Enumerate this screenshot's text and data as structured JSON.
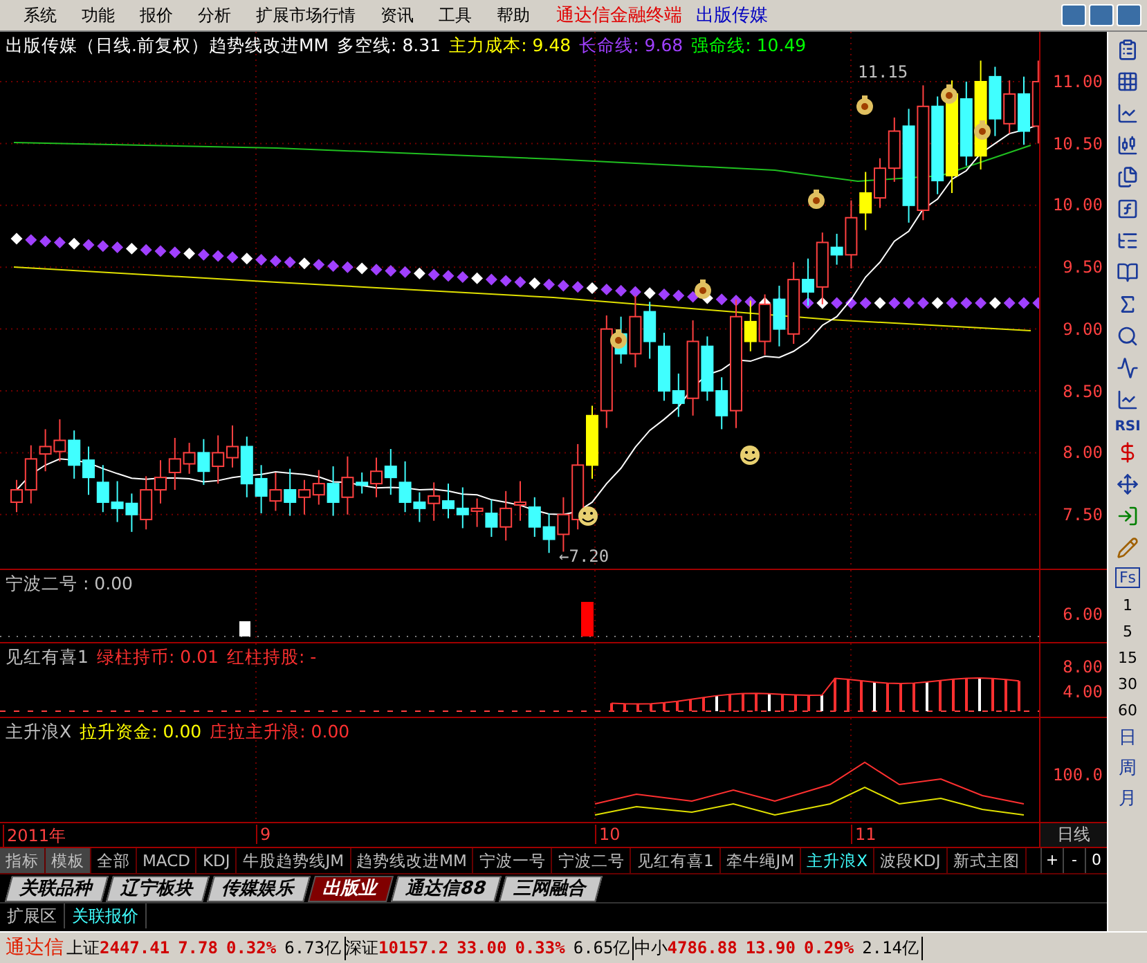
{
  "menu": [
    "系统",
    "功能",
    "报价",
    "分析",
    "扩展市场行情",
    "资讯",
    "工具",
    "帮助"
  ],
  "brand": {
    "product": "通达信金融终端",
    "stock": "出版传媒"
  },
  "chart": {
    "legend": [
      {
        "text": "出版传媒（日线.前复权）趋势线改进MM",
        "color": "#ffffff"
      },
      {
        "text": "多空线: 8.31",
        "color": "#ffffff"
      },
      {
        "text": "主力成本: 9.48",
        "color": "#ffff00"
      },
      {
        "text": "长命线: 9.68",
        "color": "#a040ff"
      },
      {
        "text": "强命线: 10.49",
        "color": "#00ff00"
      }
    ],
    "high_label": "11.15",
    "low_label": "←7.20",
    "y_labels": [
      "11.00",
      "10.50",
      "10.00",
      "9.50",
      "9.00",
      "8.50",
      "8.00",
      "7.50"
    ]
  },
  "indicators": [
    {
      "kind": "signal",
      "legend": [
        {
          "text": "宁波二号 : 0.00",
          "color": "#c0c0c0"
        }
      ],
      "y_labels": [
        "6.00"
      ]
    },
    {
      "kind": "bars",
      "legend": [
        {
          "text": "见红有喜1",
          "color": "#c0c0c0"
        },
        {
          "text": "绿柱持币: 0.01",
          "color": "#ff3030"
        },
        {
          "text": "红柱持股: -",
          "color": "#ff3030"
        }
      ],
      "y_labels": [
        "8.00",
        "4.00"
      ]
    },
    {
      "kind": "lines",
      "legend": [
        {
          "text": "主升浪X",
          "color": "#c0c0c0"
        },
        {
          "text": "拉升资金: 0.00",
          "color": "#ffff00"
        },
        {
          "text": "庄拉主升浪: 0.00",
          "color": "#ff3030"
        }
      ],
      "y_labels": [
        "100.0"
      ]
    }
  ],
  "dates": [
    "2011年",
    "9",
    "10",
    "11"
  ],
  "period": "日线",
  "indicator_tabs": [
    {
      "label": "指标",
      "selected": false
    },
    {
      "label": "模板",
      "selected": false
    },
    {
      "label": "全部",
      "selected": false
    },
    {
      "label": "MACD",
      "selected": false
    },
    {
      "label": "KDJ",
      "selected": false
    },
    {
      "label": "牛股趋势线JM",
      "selected": false
    },
    {
      "label": "趋势线改进MM",
      "selected": false
    },
    {
      "label": "宁波一号",
      "selected": false
    },
    {
      "label": "宁波二号",
      "selected": false
    },
    {
      "label": "见红有喜1",
      "selected": false
    },
    {
      "label": "牵牛绳JM",
      "selected": false
    },
    {
      "label": "主升浪X",
      "selected": true
    },
    {
      "label": "波段KDJ",
      "selected": false
    },
    {
      "label": "新式主图",
      "selected": false
    }
  ],
  "tab_controls": [
    "+",
    "-",
    "0"
  ],
  "block_tabs": [
    {
      "label": "关联品种",
      "selected": false
    },
    {
      "label": "辽宁板块",
      "selected": false
    },
    {
      "label": "传媒娱乐",
      "selected": false
    },
    {
      "label": "出版业",
      "selected": true
    },
    {
      "label": "通达信88",
      "selected": false
    },
    {
      "label": "三网融合",
      "selected": false
    }
  ],
  "ext_tabs": [
    {
      "label": "扩展区",
      "selected": false
    },
    {
      "label": "关联报价",
      "selected": true
    }
  ],
  "toolbar_label": "RSI",
  "side_periods": [
    "Fs",
    "1",
    "5",
    "15",
    "30",
    "60"
  ],
  "side_cycles": [
    "日",
    "周",
    "月"
  ],
  "status": {
    "brand": "通达信",
    "indices": [
      {
        "name": "上证",
        "value": "2447.41",
        "change": "7.78",
        "pct": "0.32%",
        "amount": "6.73亿"
      },
      {
        "name": "深证",
        "value": "10157.2",
        "change": "33.00",
        "pct": "0.33%",
        "amount": "6.65亿"
      },
      {
        "name": "中小",
        "value": "4786.88",
        "change": "13.90",
        "pct": "0.29%",
        "amount": "2.14亿"
      }
    ]
  }
}
